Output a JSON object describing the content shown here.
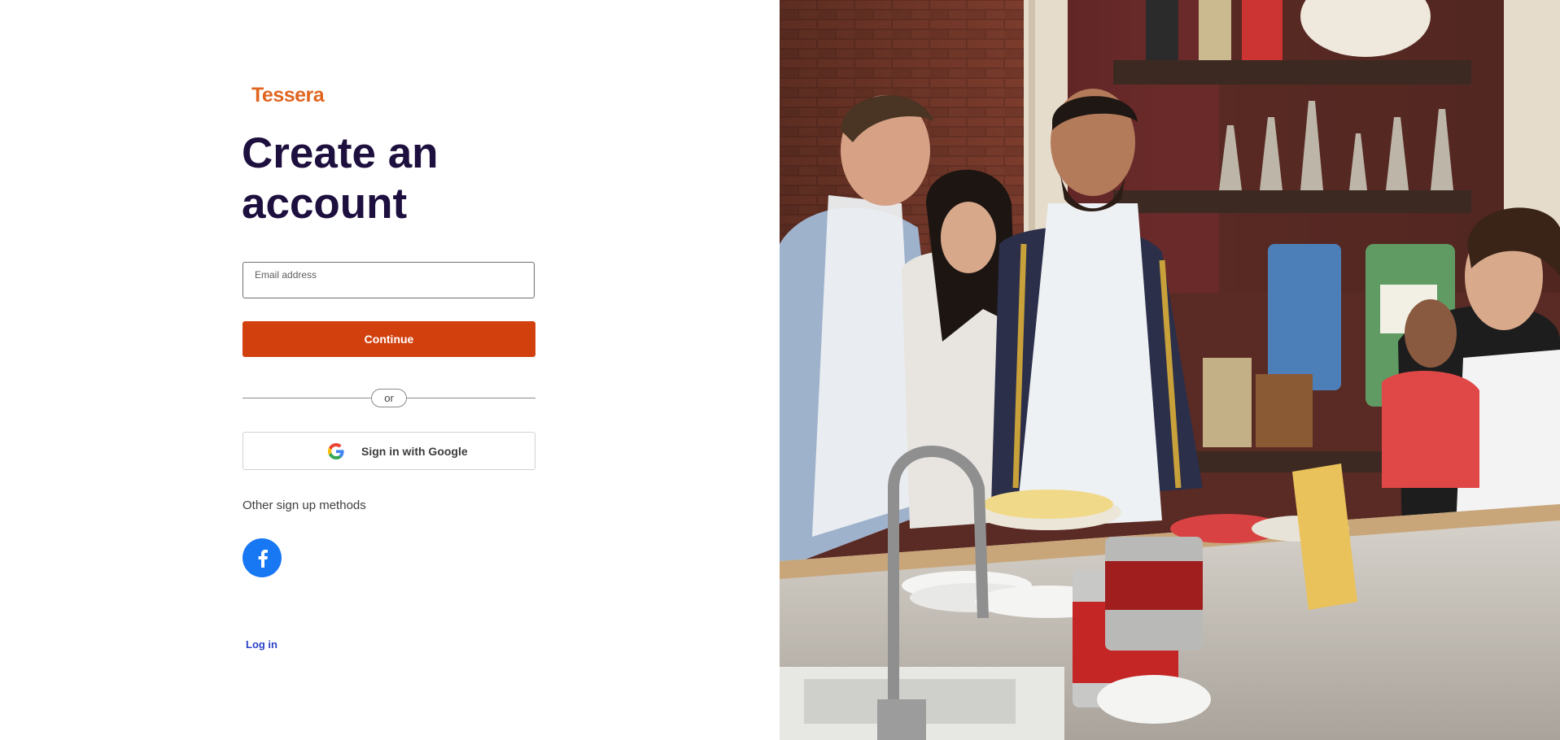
{
  "brand": {
    "name": "Tessera",
    "color": "#e0661f"
  },
  "page_title": "Create an account",
  "email": {
    "label": "Email address",
    "value": ""
  },
  "continue_label": "Continue",
  "divider_text": "or",
  "google": {
    "label": "Sign in with Google",
    "icon": "google-icon"
  },
  "other_methods": {
    "heading": "Other sign up methods",
    "facebook_icon": "facebook-icon",
    "facebook_color": "#1877f2"
  },
  "login_link": "Log in",
  "colors": {
    "title": "#1d0f3e",
    "primary_button": "#d2400e",
    "link": "#2a43c9"
  },
  "hero_image": {
    "subject": "cooking-class-photo"
  }
}
